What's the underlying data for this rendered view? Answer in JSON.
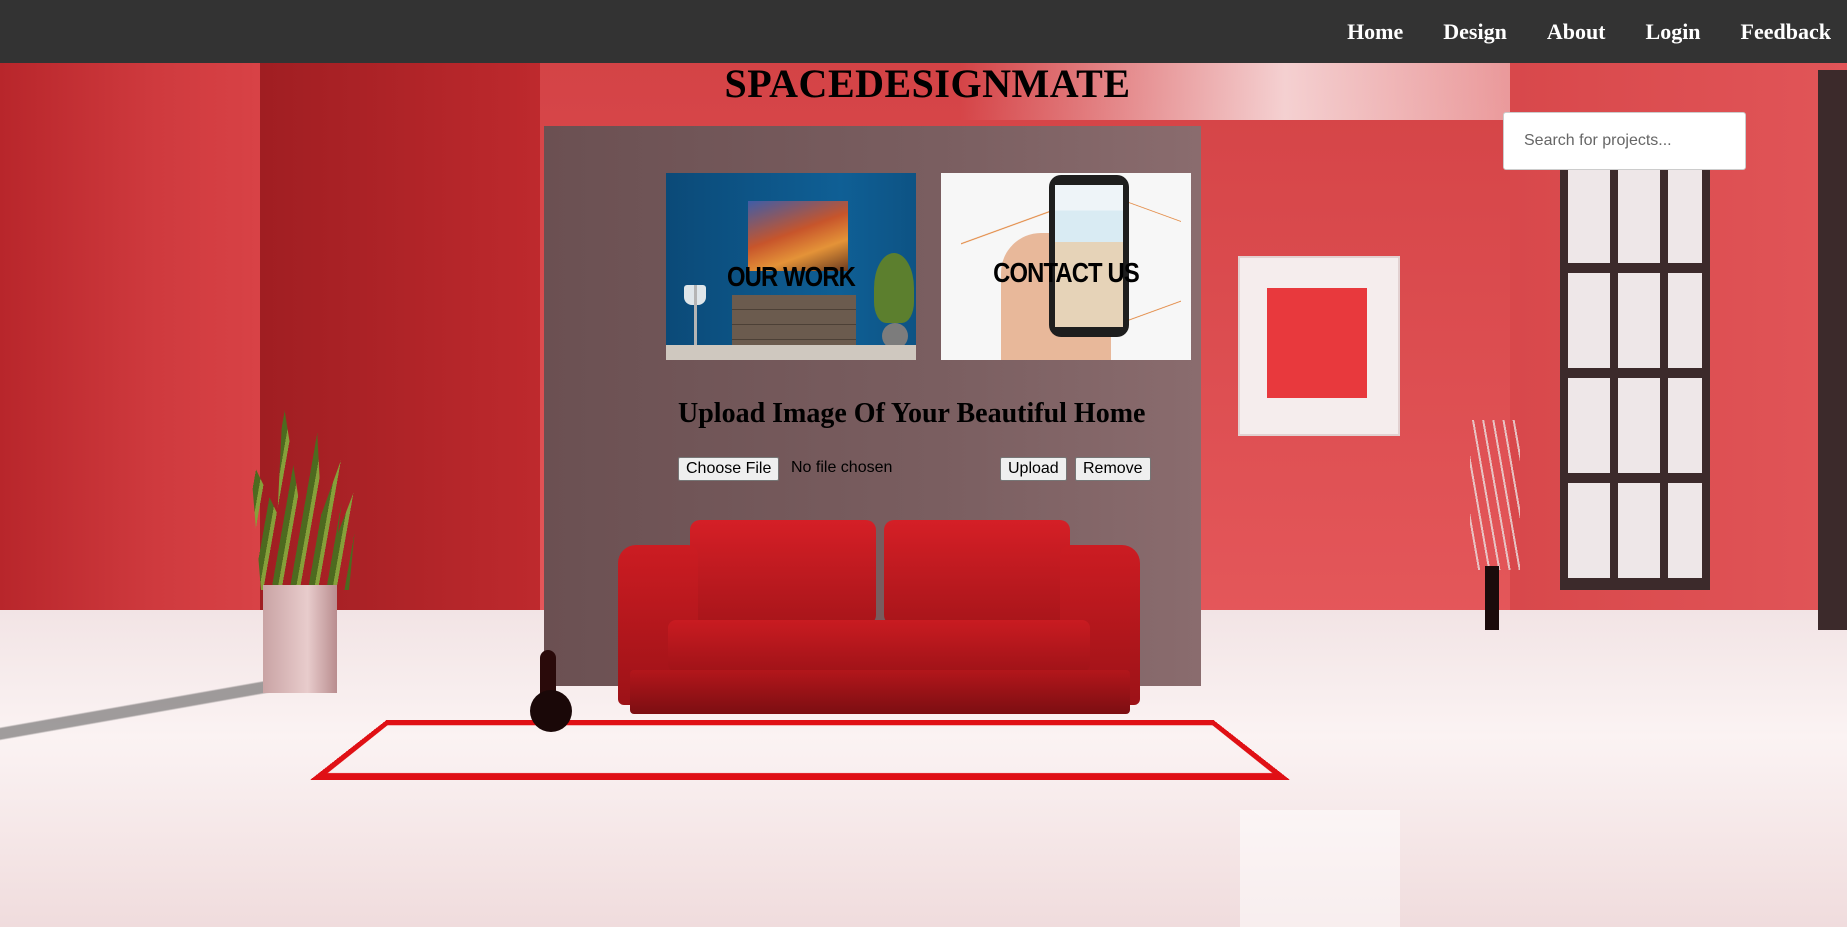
{
  "nav": {
    "items": [
      {
        "label": "Home"
      },
      {
        "label": "Design"
      },
      {
        "label": "About"
      },
      {
        "label": "Login"
      },
      {
        "label": "Feedback"
      }
    ]
  },
  "site": {
    "title": "SPACEDESIGNMATE"
  },
  "search": {
    "placeholder": "Search for projects...",
    "value": ""
  },
  "cards": {
    "work": {
      "label": "OUR WORK"
    },
    "contact": {
      "label": "CONTACT US"
    }
  },
  "upload": {
    "heading": "Upload Image Of Your Beautiful Home",
    "choose_label": "Choose File",
    "status": "No file chosen",
    "upload_label": "Upload",
    "remove_label": "Remove"
  },
  "colors": {
    "navbar": "#333333",
    "nav_text": "#ffffff",
    "wall": "#c42a30",
    "sofa": "#d51f26"
  }
}
